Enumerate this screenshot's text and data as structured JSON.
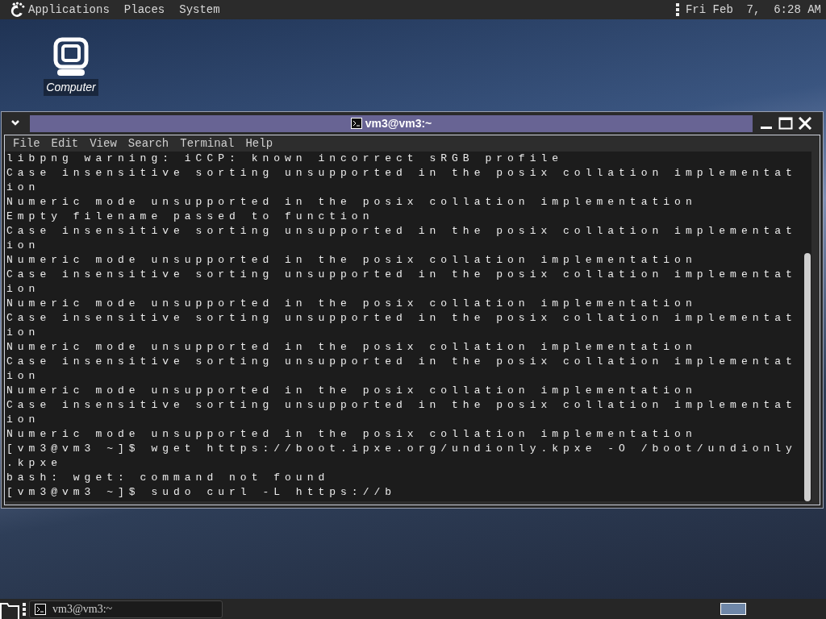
{
  "top_panel": {
    "menus": [
      "Applications",
      "Places",
      "System"
    ],
    "clock": "Fri Feb  7,  6:28 AM"
  },
  "desktop_icons": [
    {
      "label": "Computer"
    }
  ],
  "window": {
    "title": "vm3@vm3:~",
    "menu": [
      "File",
      "Edit",
      "View",
      "Search",
      "Terminal",
      "Help"
    ],
    "lines": [
      "libpng warning: iCCP: known incorrect sRGB profile",
      "Case insensitive sorting unsupported in the posix collation implementat",
      "ion",
      "Numeric mode unsupported in the posix collation implementation",
      "Empty filename passed to function",
      "Case insensitive sorting unsupported in the posix collation implementat",
      "ion",
      "Numeric mode unsupported in the posix collation implementation",
      "Case insensitive sorting unsupported in the posix collation implementat",
      "ion",
      "Numeric mode unsupported in the posix collation implementation",
      "Case insensitive sorting unsupported in the posix collation implementat",
      "ion",
      "Numeric mode unsupported in the posix collation implementation",
      "Case insensitive sorting unsupported in the posix collation implementat",
      "ion",
      "Numeric mode unsupported in the posix collation implementation",
      "Case insensitive sorting unsupported in the posix collation implementat",
      "ion",
      "Numeric mode unsupported in the posix collation implementation",
      "[vm3@vm3 ~]$ wget https://boot.ipxe.org/undionly.kpxe -O /boot/undionly",
      ".kpxe",
      "bash: wget: command not found",
      "[vm3@vm3 ~]$ sudo curl -L https://b"
    ]
  },
  "taskbar": {
    "tasks": [
      {
        "label": "vm3@vm3:~",
        "selected": false
      }
    ]
  }
}
